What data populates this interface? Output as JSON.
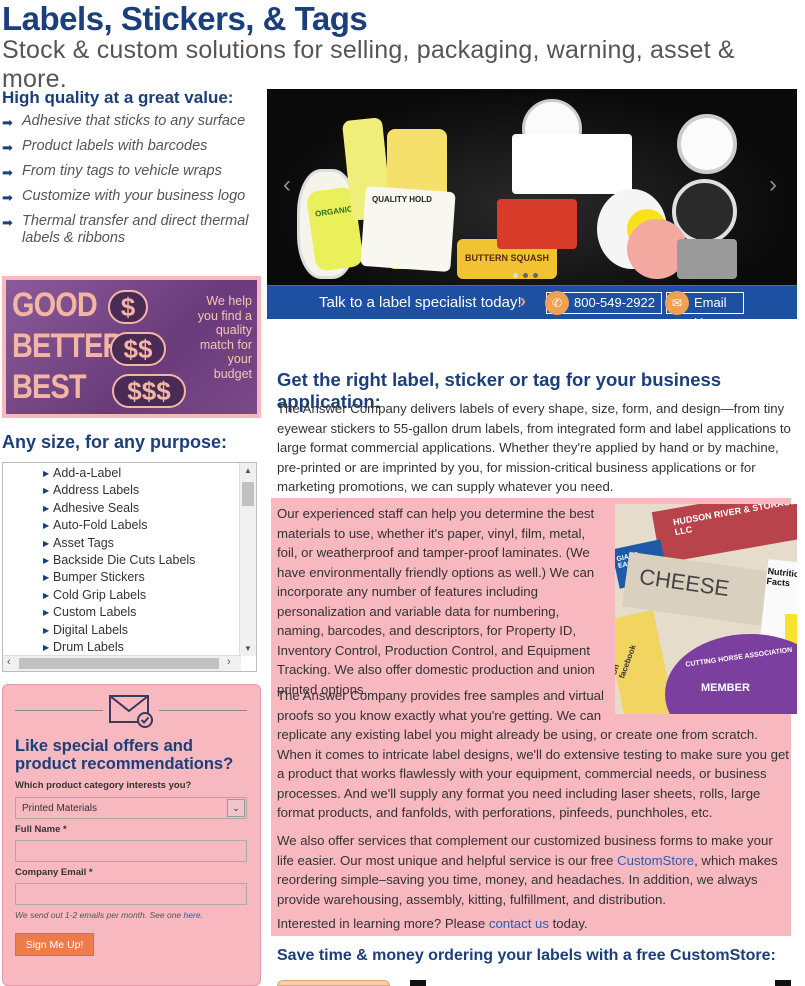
{
  "header": {
    "title": "Labels, Stickers, & Tags",
    "subtitle": "Stock & custom solutions for selling, packaging, warning, asset & more."
  },
  "features": {
    "heading": "High quality at a great value:",
    "items": [
      "Adhesive that sticks to any surface",
      "Product labels with barcodes",
      "From tiny tags to vehicle wraps",
      "Customize with your business logo",
      "Thermal transfer and direct thermal labels & ribbons"
    ]
  },
  "promo": {
    "good": "GOOD",
    "better": "BETTER",
    "best": "BEST",
    "tier1": "$",
    "tier2": "$$",
    "tier3": "$$$",
    "text": "We help you find a quality match for your budget"
  },
  "category_list": {
    "heading": "Any size, for any purpose:",
    "items": [
      "Add-a-Label",
      "Address Labels",
      "Adhesive Seals",
      "Auto-Fold Labels",
      "Asset Tags",
      "Backside Die Cuts Labels",
      "Bumper Stickers",
      "Cold Grip Labels",
      "Custom Labels",
      "Digital Labels",
      "Drum Labels"
    ]
  },
  "offer_form": {
    "heading": "Like special offers and product recommendations?",
    "category_label": "Which product category interests you?",
    "category_value": "Printed Materials",
    "name_label": "Full Name *",
    "email_label": "Company Email *",
    "note_text": "We send out 1-2 emails per month. See one ",
    "note_link": "here.",
    "submit_label": "Sign Me Up!"
  },
  "hero": {
    "cta_text": "Talk to a label specialist today!",
    "phone": "800-549-2922",
    "email_label": "Email Us",
    "carousel_dots": 3
  },
  "content": {
    "heading": "Get the right label, sticker or tag for your business application:",
    "p1": "The Answer Company delivers labels of every shape, size, form, and design—from tiny eyewear stickers to 55-gallon drum labels, from integrated form and label applications to large format commercial applications. Whether they're applied by hand or by machine, pre-printed or are imprinted by you, for mission-critical business applications or for marketing promotions, we can supply whatever you need.",
    "p2": "Our experienced staff can help you determine the best materials to use, whether it's paper, vinyl, film, metal, foil, or weatherproof and tamper-proof laminates. (We have environmentally friendly options as well.) We can incorporate any number of features including personalization and variable data for numbering, naming, barcodes, and descriptors, for Property ID, Inventory Control, Production Control, and Equipment Tracking. We also offer domestic production and union printed options.",
    "p3a": "The Answer Company provides free samples and virtual proofs so you know exactly what you're getting. We can",
    "p3b": "replicate any existing label you might already be using, or create one from scratch. When it comes to intricate label designs, we'll do extensive testing to make sure you get a product that works flawlessly with your equipment, commercial needs, or business processes. And we'll supply any format you need including laser sheets, rolls, large format products, and fanfolds, with perforations, pinfeeds, punchholes, etc.",
    "p4_start": "We also offer services that complement our customized business forms to make your life easier. Our most unique and helpful service is our free ",
    "p4_link": "CustomStore",
    "p4_end": ", which makes reordering simple–saving you time, money, and headaches. In addition, we always provide warehousing, assembly, kitting, fulfillment, and distribution.",
    "p5_start": "Interested in learning more? Please ",
    "p5_link": "contact us",
    "p5_end": " today.",
    "save_heading": "Save time & money ordering your labels with a free CustomStore:"
  },
  "image_text": {
    "cheese": "CHEESE",
    "nutrition": "Nutrition Facts",
    "member": "MEMBER",
    "association": "CUTTING HORSE ASSOCIATION",
    "hudson": "HUDSON RIVER & STORAGE, LLC",
    "giant": "GIANT EAGLE",
    "hello": "Hello On facebook",
    "organic": "ORGANIC",
    "quality_hold": "QUALITY HOLD",
    "buttern": "BUTTERN SQUASH"
  },
  "colors": {
    "brand_blue": "#1b3f7a",
    "highlight_pink": "#f7b8c0",
    "cta_blue": "#1d4fa3",
    "button_orange": "#f07b4a",
    "link_blue": "#2a5db0"
  }
}
